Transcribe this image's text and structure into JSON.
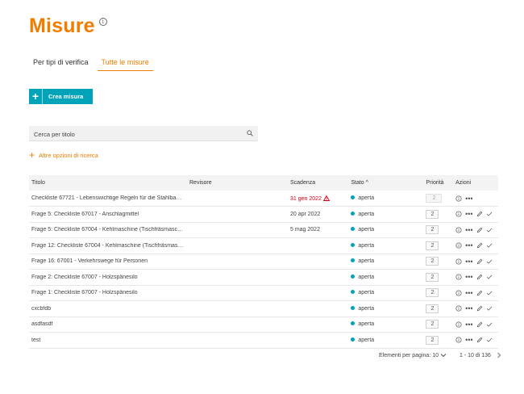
{
  "page": {
    "title": "Misure"
  },
  "tabs": [
    {
      "label": "Per tipi di verifica",
      "active": false
    },
    {
      "label": "Tutte le misure",
      "active": true
    }
  ],
  "create_button": {
    "label": "Crea misura"
  },
  "search": {
    "placeholder": "Cerca per titolo",
    "value": ""
  },
  "more_options": {
    "label": "Altre opzioni di ricerca"
  },
  "table": {
    "columns": [
      "Titolo",
      "Revisore",
      "Scadenza",
      "Stato",
      "Priorità",
      "Azioni"
    ],
    "sort_indicator": "^",
    "rows": [
      {
        "title": "Checkliste 67721 - Lebenswichtige Regeln für die Stahlbau…",
        "reviewer": "",
        "due": "31 gen 2022",
        "overdue": true,
        "state": "aperta",
        "priority": "2",
        "editable": false
      },
      {
        "title": "Frage 5: Checkliste 67017 - Anschlagmittel",
        "reviewer": "",
        "due": "20 apr 2022",
        "overdue": false,
        "state": "aperta",
        "priority": "2",
        "editable": true
      },
      {
        "title": "Frage 5: Checkliste 67004 - Kehlmaschine (Tischfräsmasch…",
        "reviewer": "",
        "due": "5 mag 2022",
        "overdue": false,
        "state": "aperta",
        "priority": "2",
        "editable": true
      },
      {
        "title": "Frage 12: Checkliste 67004 - Kehlmaschine (Tischfräsmasc…",
        "reviewer": "",
        "due": "",
        "overdue": false,
        "state": "aperta",
        "priority": "2",
        "editable": true
      },
      {
        "title": "Frage 16: 67001 - Verkehrswege für Personen",
        "reviewer": "",
        "due": "",
        "overdue": false,
        "state": "aperta",
        "priority": "2",
        "editable": true
      },
      {
        "title": "Frage 2: Checkliste 67007 - Holzspänesilo",
        "reviewer": "",
        "due": "",
        "overdue": false,
        "state": "aperta",
        "priority": "2",
        "editable": true
      },
      {
        "title": "Frage 1: Checkliste 67007 - Holzspänesilo",
        "reviewer": "",
        "due": "",
        "overdue": false,
        "state": "aperta",
        "priority": "2",
        "editable": true
      },
      {
        "title": "cxcbfdb",
        "reviewer": "",
        "due": "",
        "overdue": false,
        "state": "aperta",
        "priority": "2",
        "editable": true
      },
      {
        "title": "asdfasdf",
        "reviewer": "",
        "due": "",
        "overdue": false,
        "state": "aperta",
        "priority": "2",
        "editable": true
      },
      {
        "title": "test",
        "reviewer": "",
        "due": "",
        "overdue": false,
        "state": "aperta",
        "priority": "2",
        "editable": true
      }
    ]
  },
  "pagination": {
    "per_page_label": "Elementi per pagina:",
    "per_page": "10",
    "range": "1 - 10 di 136"
  },
  "icons": {
    "info": "info-icon",
    "plus": "plus-icon",
    "search": "search-icon",
    "warning": "warning-icon",
    "more": "more-icon",
    "edit": "edit-icon",
    "check": "check-icon",
    "chevron_down": "chevron-down-icon",
    "chevron_right": "chevron-right-icon"
  },
  "colors": {
    "brand": "#f07d00",
    "accent": "#00a3b8",
    "overdue": "#d0021b"
  }
}
